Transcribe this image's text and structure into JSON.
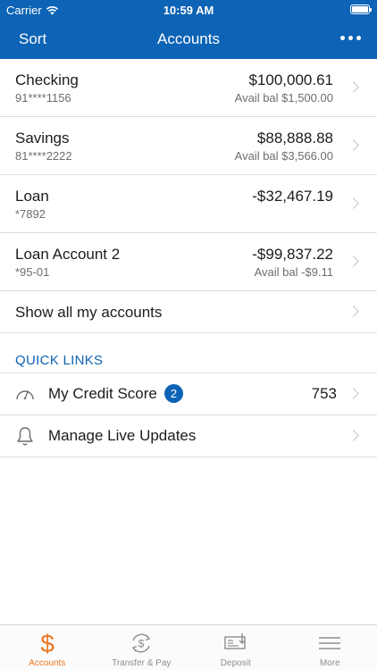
{
  "status_bar": {
    "carrier": "Carrier",
    "time": "10:59 AM"
  },
  "nav": {
    "sort_label": "Sort",
    "title": "Accounts"
  },
  "accounts": [
    {
      "name": "Checking",
      "number": "91****1156",
      "balance": "$100,000.61",
      "avail": "Avail bal $1,500.00"
    },
    {
      "name": "Savings",
      "number": "81****2222",
      "balance": "$88,888.88",
      "avail": "Avail bal $3,566.00"
    },
    {
      "name": "Loan",
      "number": "*7892",
      "balance": "-$32,467.19",
      "avail": ""
    },
    {
      "name": "Loan Account 2",
      "number": "*95-01",
      "balance": "-$99,837.22",
      "avail": "Avail bal -$9.11"
    }
  ],
  "show_all_label": "Show all my accounts",
  "quick_links": {
    "heading": "QUICK LINKS",
    "items": [
      {
        "label": "My Credit Score",
        "badge": "2",
        "value": "753",
        "icon": "gauge-icon"
      },
      {
        "label": "Manage Live Updates",
        "icon": "bell-icon"
      }
    ]
  },
  "tabbar": {
    "items": [
      {
        "label": "Accounts",
        "icon": "dollar-icon",
        "active": true
      },
      {
        "label": "Transfer & Pay",
        "icon": "transfer-icon"
      },
      {
        "label": "Deposit",
        "icon": "check-deposit-icon"
      },
      {
        "label": "More",
        "icon": "menu-icon"
      }
    ]
  },
  "colors": {
    "brand_blue": "#0d63b5",
    "active_orange": "#e87722",
    "secondary_text": "#6d6d72"
  }
}
